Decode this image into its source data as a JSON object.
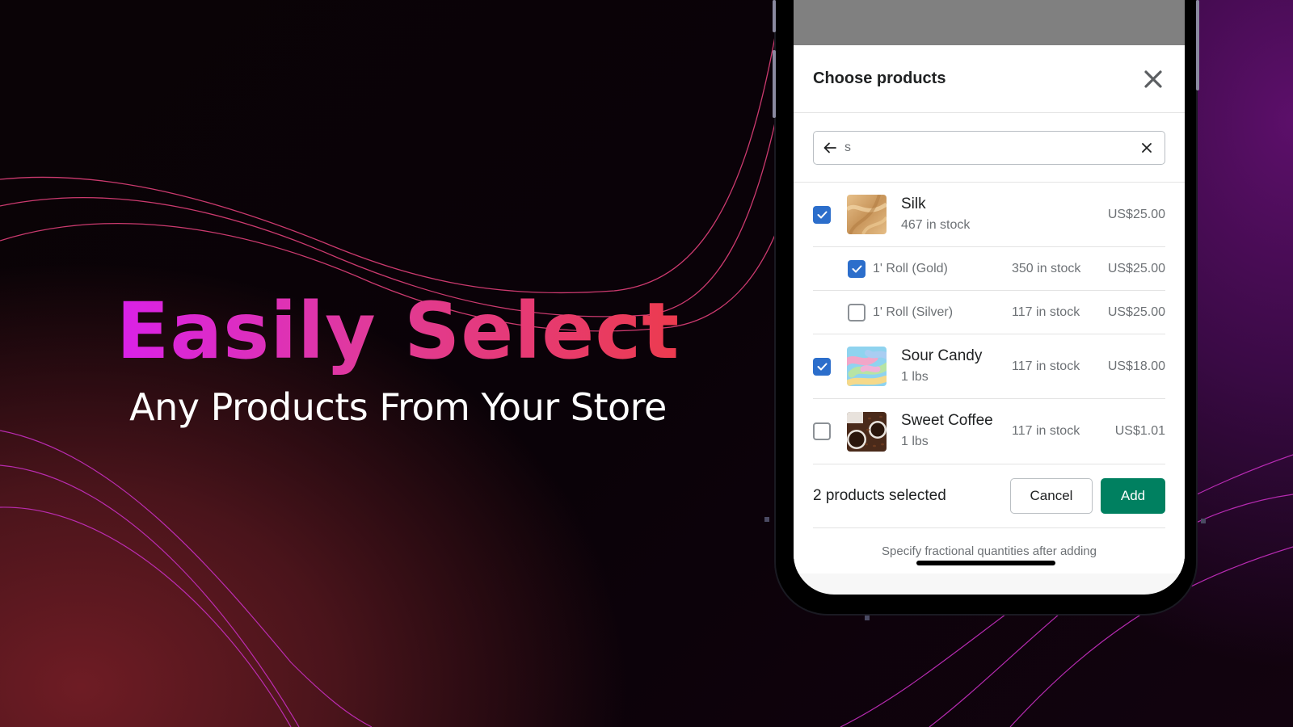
{
  "hero": {
    "title": "Easily Select",
    "subtitle": "Any Products From Your Store"
  },
  "modal": {
    "title": "Choose products",
    "close_icon": "close-icon",
    "search": {
      "value": "s",
      "back_icon": "arrow-left-icon",
      "clear_icon": "clear-icon"
    },
    "products": [
      {
        "name": "Silk",
        "subtitle": "467 in stock",
        "stock": "",
        "price": "US$25.00",
        "checked": true,
        "thumbnail": "silk-image",
        "variants": [
          {
            "name": "1' Roll (Gold)",
            "stock": "350 in stock",
            "price": "US$25.00",
            "checked": true
          },
          {
            "name": "1' Roll (Silver)",
            "stock": "117 in stock",
            "price": "US$25.00",
            "checked": false
          }
        ]
      },
      {
        "name": "Sour Candy",
        "subtitle": "1 lbs",
        "stock": "117 in stock",
        "price": "US$18.00",
        "checked": true,
        "thumbnail": "sour-candy-image",
        "variants": []
      },
      {
        "name": "Sweet Coffee",
        "subtitle": "1 lbs",
        "stock": "117 in stock",
        "price": "US$1.01",
        "checked": false,
        "thumbnail": "sweet-coffee-image",
        "variants": []
      }
    ],
    "footer": {
      "selected_count": "2 products selected",
      "cancel_label": "Cancel",
      "add_label": "Add",
      "hint": "Specify fractional quantities after adding"
    }
  },
  "colors": {
    "checkbox_checked": "#2c6ecb",
    "primary_button": "#008060",
    "title_gradient_start": "#d921e8",
    "title_gradient_end": "#ec3b4e"
  }
}
